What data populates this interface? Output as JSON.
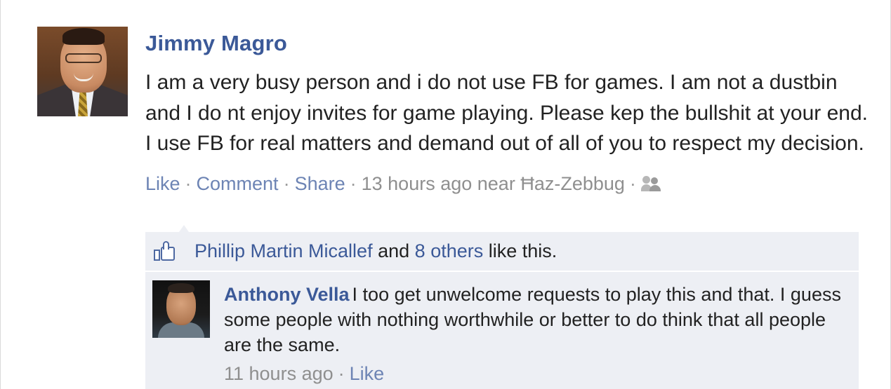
{
  "post": {
    "author": "Jimmy Magro",
    "message": "I am a very busy person and i do not use FB for games. I am not a dustbin and I do nt enjoy invites for game playing. Please kep the bullshit at your end. I use FB for real matters and demand out of all of you to respect my decision.",
    "actions": {
      "like": "Like",
      "comment": "Comment",
      "share": "Share",
      "separator": "·"
    },
    "timestamp": "13 hours ago",
    "location_prefix": "near",
    "location": "Ħaz-Zebbug",
    "privacy_icon": "friends-icon"
  },
  "likes": {
    "icon": "thumbs-up-icon",
    "first_liker": "Phillip Martin Micallef",
    "conjunction": "and",
    "others_link": "8 others",
    "suffix": "like this."
  },
  "comments": [
    {
      "author": "Anthony Vella",
      "text": "I too get unwelcome requests to play this and that. I guess some people with nothing worthwhile or better to do think that all people are the same.",
      "timestamp": "11 hours ago",
      "like_label": "Like",
      "separator": "·"
    }
  ],
  "colors": {
    "link_blue": "#3b5998",
    "action_blue": "#6d84b4",
    "ufi_background": "#edeff4",
    "meta_gray": "#8f8f8f"
  }
}
